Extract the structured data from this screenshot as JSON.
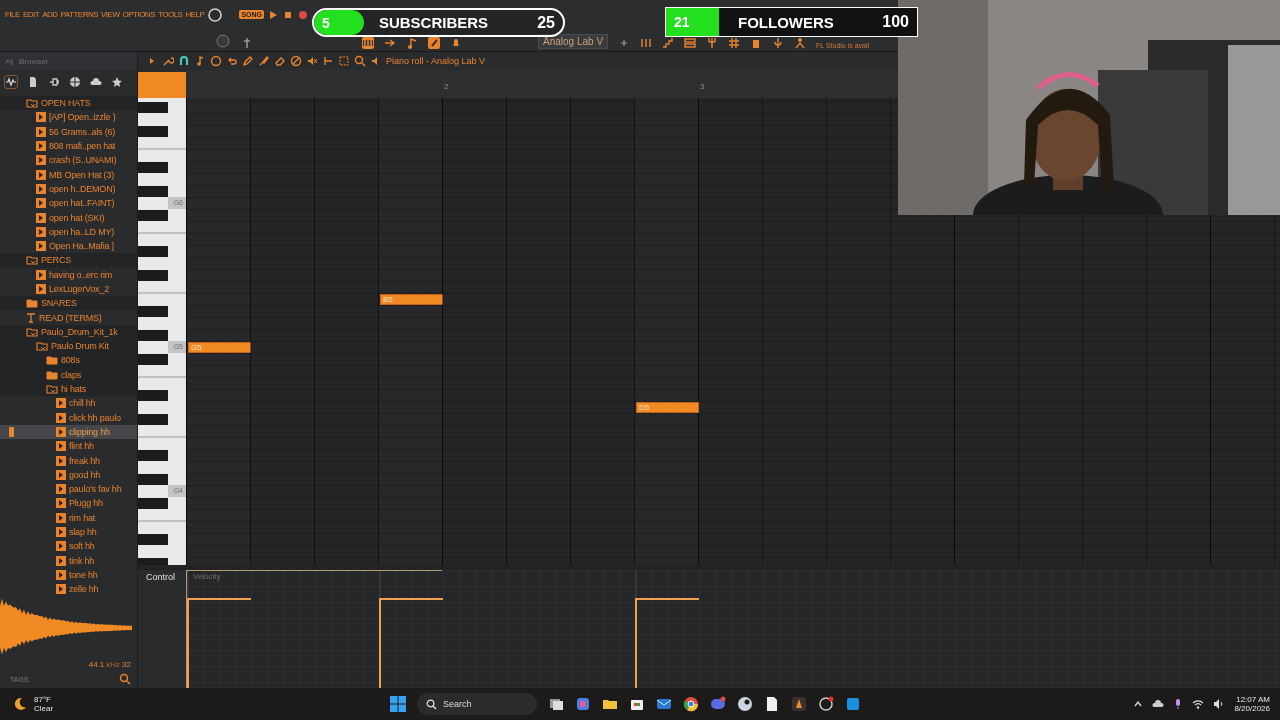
{
  "menu": [
    "FILE",
    "EDIT",
    "ADD",
    "PATTERNS",
    "VIEW",
    "OPTIONS",
    "TOOLS",
    "HELP"
  ],
  "transport": {
    "mode": "SONG"
  },
  "toolbar": {
    "instrument": "Analog Lab V",
    "hint": "FL Studio is avail"
  },
  "browser": {
    "title": "Browser",
    "tree": [
      {
        "label": "OPEN HATS",
        "kind": "folder",
        "expanded": true,
        "selected": false,
        "children": [
          {
            "label": "[AP] Open..izzle )",
            "kind": "file",
            "selected": false
          },
          {
            "label": "56 Grams..als (6)",
            "kind": "file",
            "selected": false
          },
          {
            "label": "808 mafi..pen hat",
            "kind": "file",
            "selected": false
          },
          {
            "label": "crash (S..UNAMI)",
            "kind": "file",
            "selected": false
          },
          {
            "label": "MB Open Hat (3)",
            "kind": "file",
            "selected": false
          },
          {
            "label": "open h..DEMON)",
            "kind": "file",
            "selected": false
          },
          {
            "label": "open hat..FAINT)",
            "kind": "file",
            "selected": false
          },
          {
            "label": "open hat (SKI)",
            "kind": "file",
            "selected": false
          },
          {
            "label": "open ha..LD MY)",
            "kind": "file",
            "selected": false
          },
          {
            "label": "Open Ha..Mafia ]",
            "kind": "file",
            "selected": false
          }
        ]
      },
      {
        "label": "PERCS",
        "kind": "folder",
        "expanded": true,
        "selected": false,
        "children": [
          {
            "label": "having o..erc rim",
            "kind": "file",
            "selected": false
          },
          {
            "label": "LexLugerVox_2",
            "kind": "file",
            "selected": false
          }
        ]
      },
      {
        "label": "SNARES",
        "kind": "folder",
        "expanded": false,
        "selected": false
      },
      {
        "label": "READ (TERMS)",
        "kind": "text",
        "selected": false
      },
      {
        "label": "Paulo_Drum_Kit_1k",
        "kind": "folder",
        "expanded": true,
        "selected": false,
        "children": [
          {
            "label": "Paulo Drum Kit",
            "kind": "folder",
            "expanded": true,
            "selected": false,
            "children": [
              {
                "label": "808s",
                "kind": "folder",
                "expanded": false,
                "selected": false
              },
              {
                "label": "claps",
                "kind": "folder",
                "expanded": false,
                "selected": false
              },
              {
                "label": "hi hats",
                "kind": "folder",
                "expanded": true,
                "selected": false,
                "children": [
                  {
                    "label": "chill hh",
                    "kind": "file",
                    "selected": false
                  },
                  {
                    "label": "click hh paulo",
                    "kind": "file",
                    "selected": false
                  },
                  {
                    "label": "clipping hh",
                    "kind": "file",
                    "selected": true
                  },
                  {
                    "label": "flint hh",
                    "kind": "file",
                    "selected": false
                  },
                  {
                    "label": "freak hh",
                    "kind": "file",
                    "selected": false
                  },
                  {
                    "label": "good hh",
                    "kind": "file",
                    "selected": false
                  },
                  {
                    "label": "paulo's fav hh",
                    "kind": "file",
                    "selected": false
                  },
                  {
                    "label": "Plugg hh",
                    "kind": "file",
                    "selected": false
                  },
                  {
                    "label": "rim hat",
                    "kind": "file",
                    "selected": false
                  },
                  {
                    "label": "slap hh",
                    "kind": "file",
                    "selected": false
                  },
                  {
                    "label": "soft hh",
                    "kind": "file",
                    "selected": false
                  },
                  {
                    "label": "tink hh",
                    "kind": "file",
                    "selected": false
                  },
                  {
                    "label": "tone hh",
                    "kind": "file",
                    "selected": false
                  },
                  {
                    "label": "zelle hh",
                    "kind": "file",
                    "selected": false
                  }
                ]
              }
            ]
          }
        ]
      }
    ],
    "sample_rate": "44.1",
    "sample_unit": "kHz",
    "bit_depth": "32",
    "tags": "TAGS"
  },
  "piano_roll": {
    "title": "Piano roll - Analog Lab V",
    "bar_numbers": [
      "2",
      "3"
    ],
    "key_labels": [
      "G6",
      "G5",
      "G4"
    ],
    "beats": [
      {
        "filled": true,
        "pitch": "G5",
        "velocity": {
          "level": 0.76
        }
      },
      {
        "filled": false
      },
      {
        "filled": false
      },
      {
        "filled": true,
        "pitch": "B5",
        "velocity": {
          "level": 0.76
        }
      },
      {
        "filled": false
      },
      {
        "filled": false
      },
      {
        "filled": false
      },
      {
        "filled": true,
        "pitch": "D5",
        "velocity": {
          "level": 0.76
        }
      }
    ],
    "control": {
      "label": "Control",
      "parameter": "Velocity"
    }
  },
  "goals": [
    {
      "kind": "pill",
      "current": "5",
      "title": "SUBSCRIBERS",
      "goal": "25",
      "level": 0.2
    },
    {
      "kind": "box",
      "current": "21",
      "title": "FOLLOWERS",
      "goal": "100",
      "level": 0.21
    }
  ],
  "taskbar": {
    "weather": {
      "temperature": "87°F",
      "condition": "Clear"
    },
    "search": {
      "placeholder": "Search"
    },
    "clock": {
      "time": "12:07 AM",
      "date": "8/20/2026"
    }
  }
}
